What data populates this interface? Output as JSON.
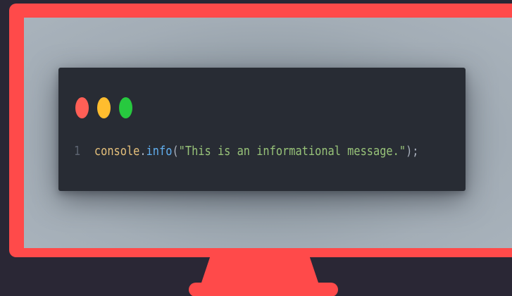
{
  "colors": {
    "background": "#2a2735",
    "monitor_frame": "#ff4a4a",
    "code_window": "#282c34",
    "dot_red": "#ff5f56",
    "dot_yellow": "#ffbd2e",
    "dot_green": "#27c93f",
    "token_object": "#e5c07b",
    "token_punct": "#abb2bf",
    "token_method": "#61afef",
    "token_string": "#98c379"
  },
  "window_controls": [
    {
      "name": "close",
      "icon": "red-dot-icon"
    },
    {
      "name": "minimize",
      "icon": "yellow-dot-icon"
    },
    {
      "name": "maximize",
      "icon": "green-dot-icon"
    }
  ],
  "code": {
    "line_number": "1",
    "tokens": {
      "object": "console",
      "dot": ".",
      "method": "info",
      "open_paren": "(",
      "string": "\"This is an informational message.\"",
      "close": ");"
    }
  }
}
